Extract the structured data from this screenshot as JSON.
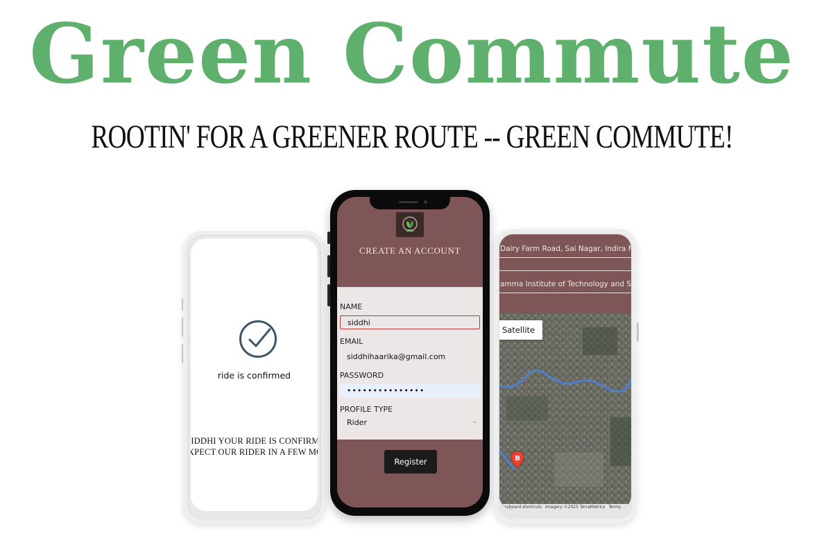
{
  "hero": {
    "title": "Green Commute",
    "tagline": "ROOTIN' FOR A GREENER ROUTE -- GREEN COMMUTE!"
  },
  "colors": {
    "brand_green": "#5fb06d",
    "app_maroon": "#7f5658",
    "form_panel": "#ece6e6",
    "button_dark": "#1c1b1b"
  },
  "left_screen": {
    "icon": "check-circle-icon",
    "title": "ride is confirmed",
    "message_line1": "SIDDHI YOUR RIDE IS CONFIRMED",
    "message_line2": "EXPECT OUR RIDER IN A FEW MOMENTS"
  },
  "center_screen": {
    "logo": "leaf-logo-icon",
    "heading": "CREATE AN ACCOUNT",
    "name_label": "NAME",
    "name_value": "siddhi",
    "email_label": "EMAIL",
    "email_value": "siddhihaarika@gmail.com",
    "password_label": "PASSWORD",
    "password_value": "•••••••••••••••",
    "profile_type_label": "PROFILE TYPE",
    "profile_type_value": "Rider",
    "register_label": "Register"
  },
  "right_screen": {
    "pickup_address": "Dairy Farm Road, Sai Nagar, Indira N",
    "drop_address": "amma Institute of Technology and Sc",
    "map_type_label": "Satellite",
    "marker_label": "B",
    "map_footer": {
      "shortcuts": "Keyboard shortcuts",
      "imagery": "Imagery ©2025 TerraMetrics",
      "terms": "Terms"
    }
  }
}
